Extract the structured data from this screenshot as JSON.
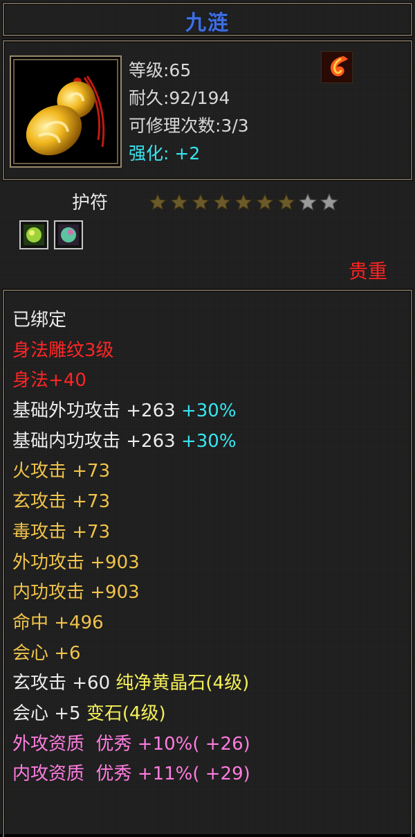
{
  "title": "九涟",
  "item": {
    "level": "等级:65",
    "durability": "耐久:92/194",
    "repair": "可修理次数:3/3",
    "enhance_label": "强化:",
    "enhance_value": "+2",
    "image": "jade-gourd-pendant",
    "element_icon": "fire-swirl-icon"
  },
  "type": "护符",
  "stars": {
    "total": 9,
    "filled": 7
  },
  "sockets": [
    "green-gem-socket",
    "teal-gem-socket"
  ],
  "rarity": "贵重",
  "colors": {
    "title": "#3f6fe0",
    "enhance": "#37e6f0",
    "rarity": "#ff2222",
    "engraving": "#ff2525",
    "attack": "#f0c34a",
    "gem": "#f5f05a",
    "aptitude": "#ff7de0"
  },
  "attributes": [
    {
      "parts": [
        {
          "t": "已绑定",
          "c": "white"
        }
      ]
    },
    {
      "parts": [
        {
          "t": "身法雕纹3级",
          "c": "red"
        }
      ]
    },
    {
      "parts": [
        {
          "t": "身法+40",
          "c": "red"
        }
      ]
    },
    {
      "parts": [
        {
          "t": "基础外功攻击 +263 ",
          "c": "white"
        },
        {
          "t": "+30%",
          "c": "cyan"
        }
      ]
    },
    {
      "parts": [
        {
          "t": "基础内功攻击 +263 ",
          "c": "white"
        },
        {
          "t": "+30%",
          "c": "cyan"
        }
      ]
    },
    {
      "parts": [
        {
          "t": "火攻击 +73",
          "c": "yellow"
        }
      ]
    },
    {
      "parts": [
        {
          "t": "玄攻击 +73",
          "c": "yellow"
        }
      ]
    },
    {
      "parts": [
        {
          "t": "毒攻击 +73",
          "c": "yellow"
        }
      ]
    },
    {
      "parts": [
        {
          "t": "外功攻击 +903",
          "c": "yellow"
        }
      ]
    },
    {
      "parts": [
        {
          "t": "内功攻击 +903",
          "c": "yellow"
        }
      ]
    },
    {
      "parts": [
        {
          "t": "命中 +496",
          "c": "yellow"
        }
      ]
    },
    {
      "parts": [
        {
          "t": "会心 +6",
          "c": "yellow"
        }
      ]
    },
    {
      "parts": [
        {
          "t": "玄攻击 +60 ",
          "c": "white"
        },
        {
          "t": "纯净黄晶石(4级)",
          "c": "bright"
        }
      ]
    },
    {
      "parts": [
        {
          "t": "会心 +5 ",
          "c": "white"
        },
        {
          "t": "变石(4级)",
          "c": "bright"
        }
      ]
    },
    {
      "parts": [
        {
          "t": "外攻资质  优秀 +10%( +26)",
          "c": "pink"
        }
      ]
    },
    {
      "parts": [
        {
          "t": "内攻资质  优秀 +11%( +29)",
          "c": "pink"
        }
      ]
    }
  ]
}
